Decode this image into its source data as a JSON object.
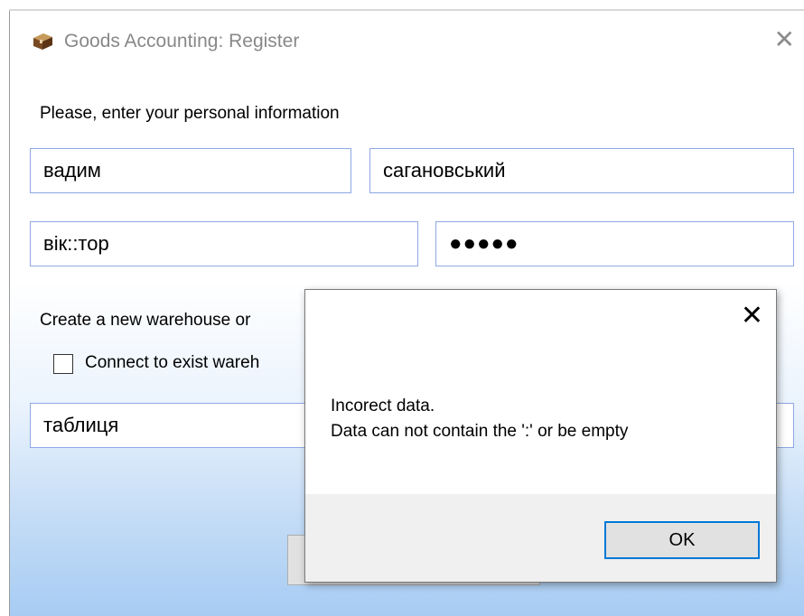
{
  "window": {
    "title": "Goods Accounting: Register",
    "close_glyph": "✕",
    "icon": "package-icon"
  },
  "form": {
    "prompt": "Please, enter your personal information",
    "first_name": "вадим",
    "last_name": "сагановський",
    "login": "вік::тор",
    "password_mask": "●●●●●",
    "warehouse_section_label": "Create a new warehouse or",
    "connect_checkbox_label": "Connect to exist wareh",
    "connect_checked": false,
    "warehouse_name": "таблиця"
  },
  "dialog": {
    "close_glyph": "✕",
    "message_line1": "Incorect data.",
    "message_line2": "Data can not contain the ':' or be empty",
    "ok_label": "OK"
  },
  "colors": {
    "field_border": "#8ea8e4",
    "ok_focus_border": "#0078d7",
    "gradient_bottom": "#a7ccf3"
  }
}
